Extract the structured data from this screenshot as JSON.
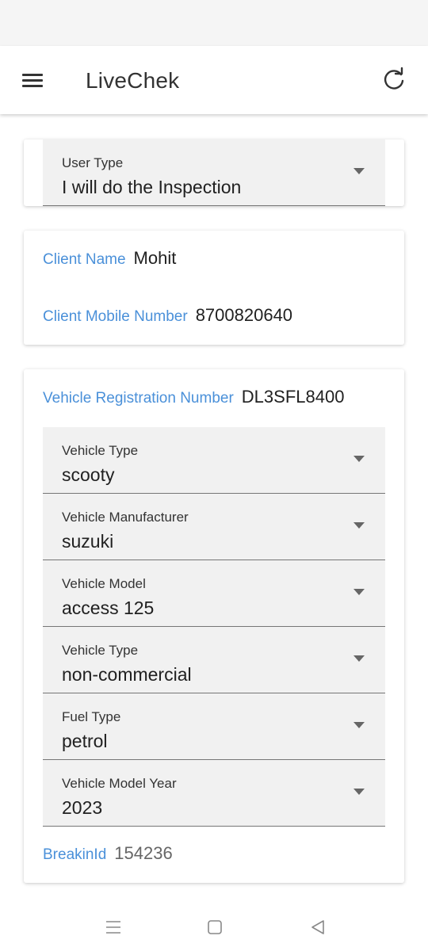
{
  "app": {
    "title": "LiveChek"
  },
  "user_type": {
    "label": "User Type",
    "value": "I will do the Inspection"
  },
  "client": {
    "name_label": "Client Name",
    "name_value": "Mohit",
    "mobile_label": "Client Mobile Number",
    "mobile_value": "8700820640"
  },
  "vehicle": {
    "reg_label": "Vehicle Registration Number",
    "reg_value": "DL3SFL8400",
    "fields": [
      {
        "label": "Vehicle Type",
        "value": "scooty"
      },
      {
        "label": "Vehicle Manufacturer",
        "value": "suzuki"
      },
      {
        "label": "Vehicle Model",
        "value": "access 125"
      },
      {
        "label": "Vehicle Type",
        "value": "non-commercial"
      },
      {
        "label": "Fuel Type",
        "value": "petrol"
      },
      {
        "label": "Vehicle Model Year",
        "value": "2023"
      }
    ],
    "breakin_label": "BreakinId",
    "breakin_value": "154236"
  },
  "colors": {
    "accent": "#4a90d9",
    "field_bg": "#f1f1f1"
  },
  "icons": [
    "menu-icon",
    "refresh-icon",
    "chevron-down-icon",
    "recent-apps-icon",
    "home-icon",
    "back-icon"
  ]
}
